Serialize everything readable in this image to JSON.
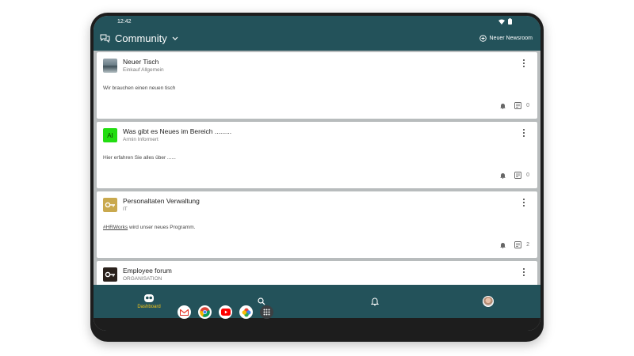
{
  "status_bar": {
    "time": "12:42"
  },
  "app_bar": {
    "title": "Community",
    "newsroom_label": "Neuer Newsroom"
  },
  "posts": [
    {
      "title": "Neuer Tisch",
      "subtitle": "Einkauf Allgemein",
      "body": "Wir brauchen einen neuen tisch",
      "comment_count": "0",
      "avatar_type": "photo"
    },
    {
      "title": "Was gibt es Neues im Bereich .........",
      "subtitle": "Armin Informert",
      "body": "Hier erfahren Sie alles über ......",
      "comment_count": "0",
      "avatar_type": "initials",
      "avatar_text": "AI",
      "avatar_color": "#22dd11"
    },
    {
      "title": "Personaltaten Verwaltung",
      "subtitle": "IT",
      "body_tag": "#HRWorks",
      "body_rest": " wird unser neues Programm.",
      "comment_count": "2",
      "avatar_type": "logo-gold"
    },
    {
      "title": "Employee forum",
      "subtitle": "ORGANISATION",
      "avatar_type": "logo-dark"
    }
  ],
  "bottom_nav": {
    "dashboard_label": "Dashboard"
  },
  "colors": {
    "primary": "#23525a",
    "accent": "#f5c518",
    "feed_background": "#b8bcbd"
  },
  "dock_apps": [
    "gmail-icon",
    "chrome-icon",
    "youtube-icon",
    "photos-icon",
    "app-drawer-icon"
  ]
}
